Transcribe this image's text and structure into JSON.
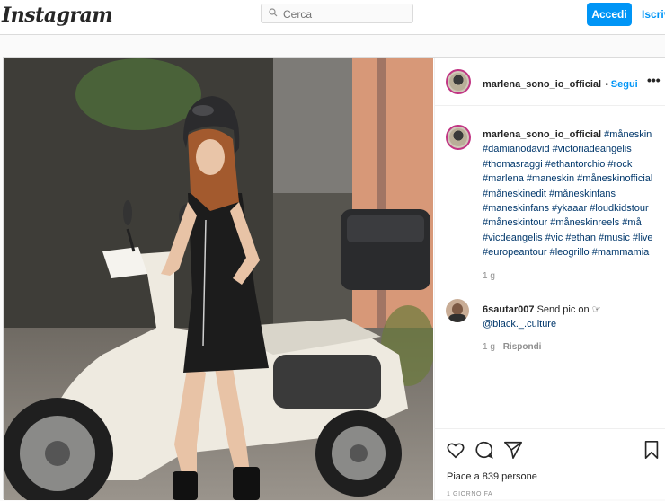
{
  "nav": {
    "logo": "Instagram",
    "search_placeholder": "Cerca",
    "login_label": "Accedi",
    "signup_label": "Iscriviti"
  },
  "post": {
    "username": "marlena_sono_io_official",
    "follow_label": "Segui",
    "more_label": "•••",
    "caption_username": "marlena_sono_io_official",
    "caption_text": "#måneskin #damianodavid #victoriadeangelis #thomasraggi #ethantorchio #rock #marlena #maneskin #måneskinofficial #måneskinedit #måneskinfans #maneskinfans #ykaaar #loudkidstour #måneskintour #måneskinreels #må #vicdeangelis #vic #ethan #music #live #europeantour #leogrillo #mammamia",
    "caption_age": "1 g",
    "comment": {
      "username": "6sautar007",
      "text": "Send pic on ☞",
      "mention": "@black._.culture",
      "age": "1 g",
      "reply_label": "Rispondi"
    },
    "likes_text": "Piace a 839 persone",
    "posted_ago": "1 GIORNO FA"
  },
  "colors": {
    "accent": "#0095f6",
    "story_ring": "#c13584",
    "hashtag": "#00376b"
  }
}
